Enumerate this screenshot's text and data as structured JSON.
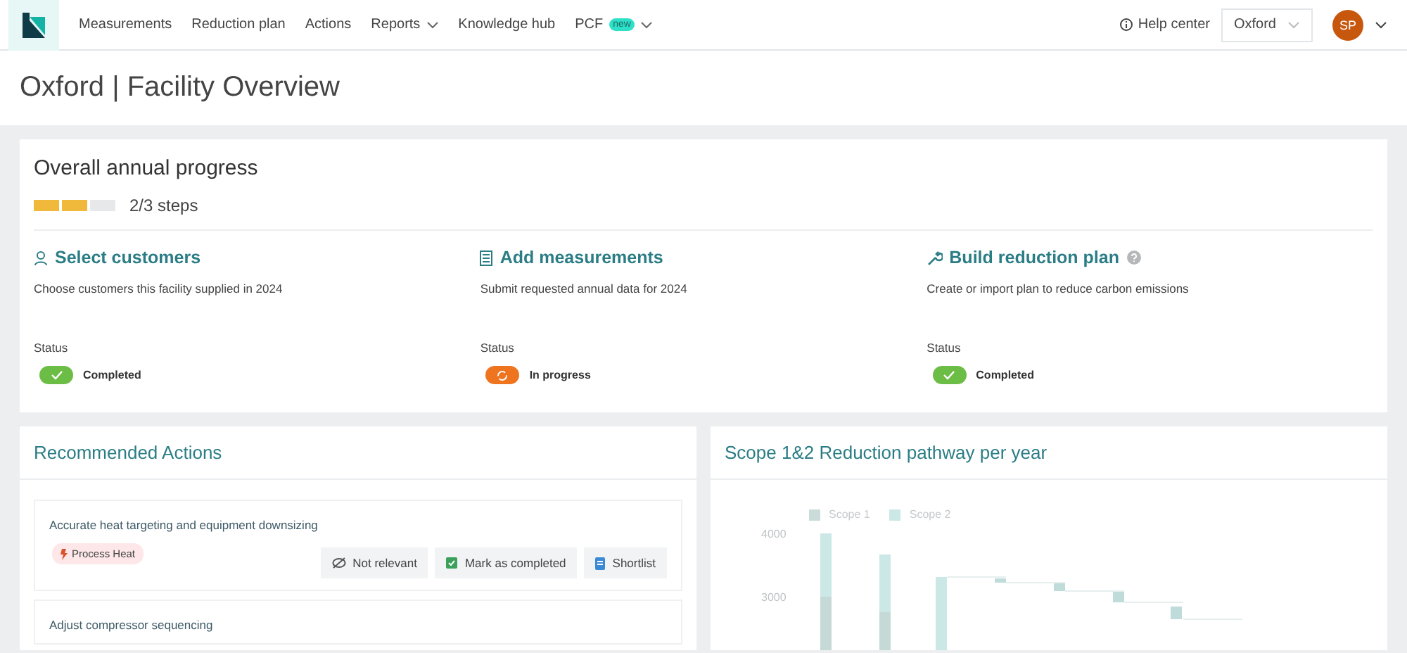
{
  "nav": {
    "items": [
      {
        "label": "Measurements",
        "dropdown": false
      },
      {
        "label": "Reduction plan",
        "dropdown": false
      },
      {
        "label": "Actions",
        "dropdown": false
      },
      {
        "label": "Reports",
        "dropdown": true
      },
      {
        "label": "Knowledge hub",
        "dropdown": false
      },
      {
        "label": "PCF",
        "badge": "new",
        "dropdown": true
      }
    ],
    "help": "Help center",
    "location": "Oxford",
    "avatar": "SP"
  },
  "page_title": "Oxford | Facility Overview",
  "progress": {
    "title": "Overall annual progress",
    "steps": [
      {
        "done": true
      },
      {
        "done": true
      },
      {
        "done": false
      }
    ],
    "steps_label": "2/3 steps",
    "tasks": [
      {
        "title": "Select customers",
        "help": false,
        "description": "Choose customers this facility supplied in 2024",
        "status_label": "Status",
        "completed": true,
        "status_text": "Completed"
      },
      {
        "title": "Add measurements",
        "help": false,
        "description": "Submit requested annual data for 2024",
        "status_label": "Status",
        "completed": false,
        "status_text": "In progress"
      },
      {
        "title": "Build reduction plan",
        "help": true,
        "description": "Create or import plan to reduce carbon emissions",
        "status_label": "Status",
        "completed": true,
        "status_text": "Completed"
      }
    ]
  },
  "actions": {
    "title": "Recommended Actions",
    "items": [
      {
        "title": "Accurate heat targeting and equipment downsizing",
        "tag": "Process Heat",
        "buttons": [
          {
            "kind": "hide",
            "label": "Not relevant"
          },
          {
            "kind": "complete",
            "label": "Mark as completed"
          },
          {
            "kind": "shortlist",
            "label": "Shortlist"
          }
        ]
      },
      {
        "title": "Adjust compressor sequencing"
      }
    ]
  },
  "pathway": {
    "title": "Scope 1&2 Reduction pathway per year",
    "legend": [
      {
        "label": "Scope 1",
        "color": "#c9dcda"
      },
      {
        "label": "Scope 2",
        "color": "#cbe8e6"
      }
    ],
    "ticks": [
      "4000",
      "3000"
    ]
  }
}
